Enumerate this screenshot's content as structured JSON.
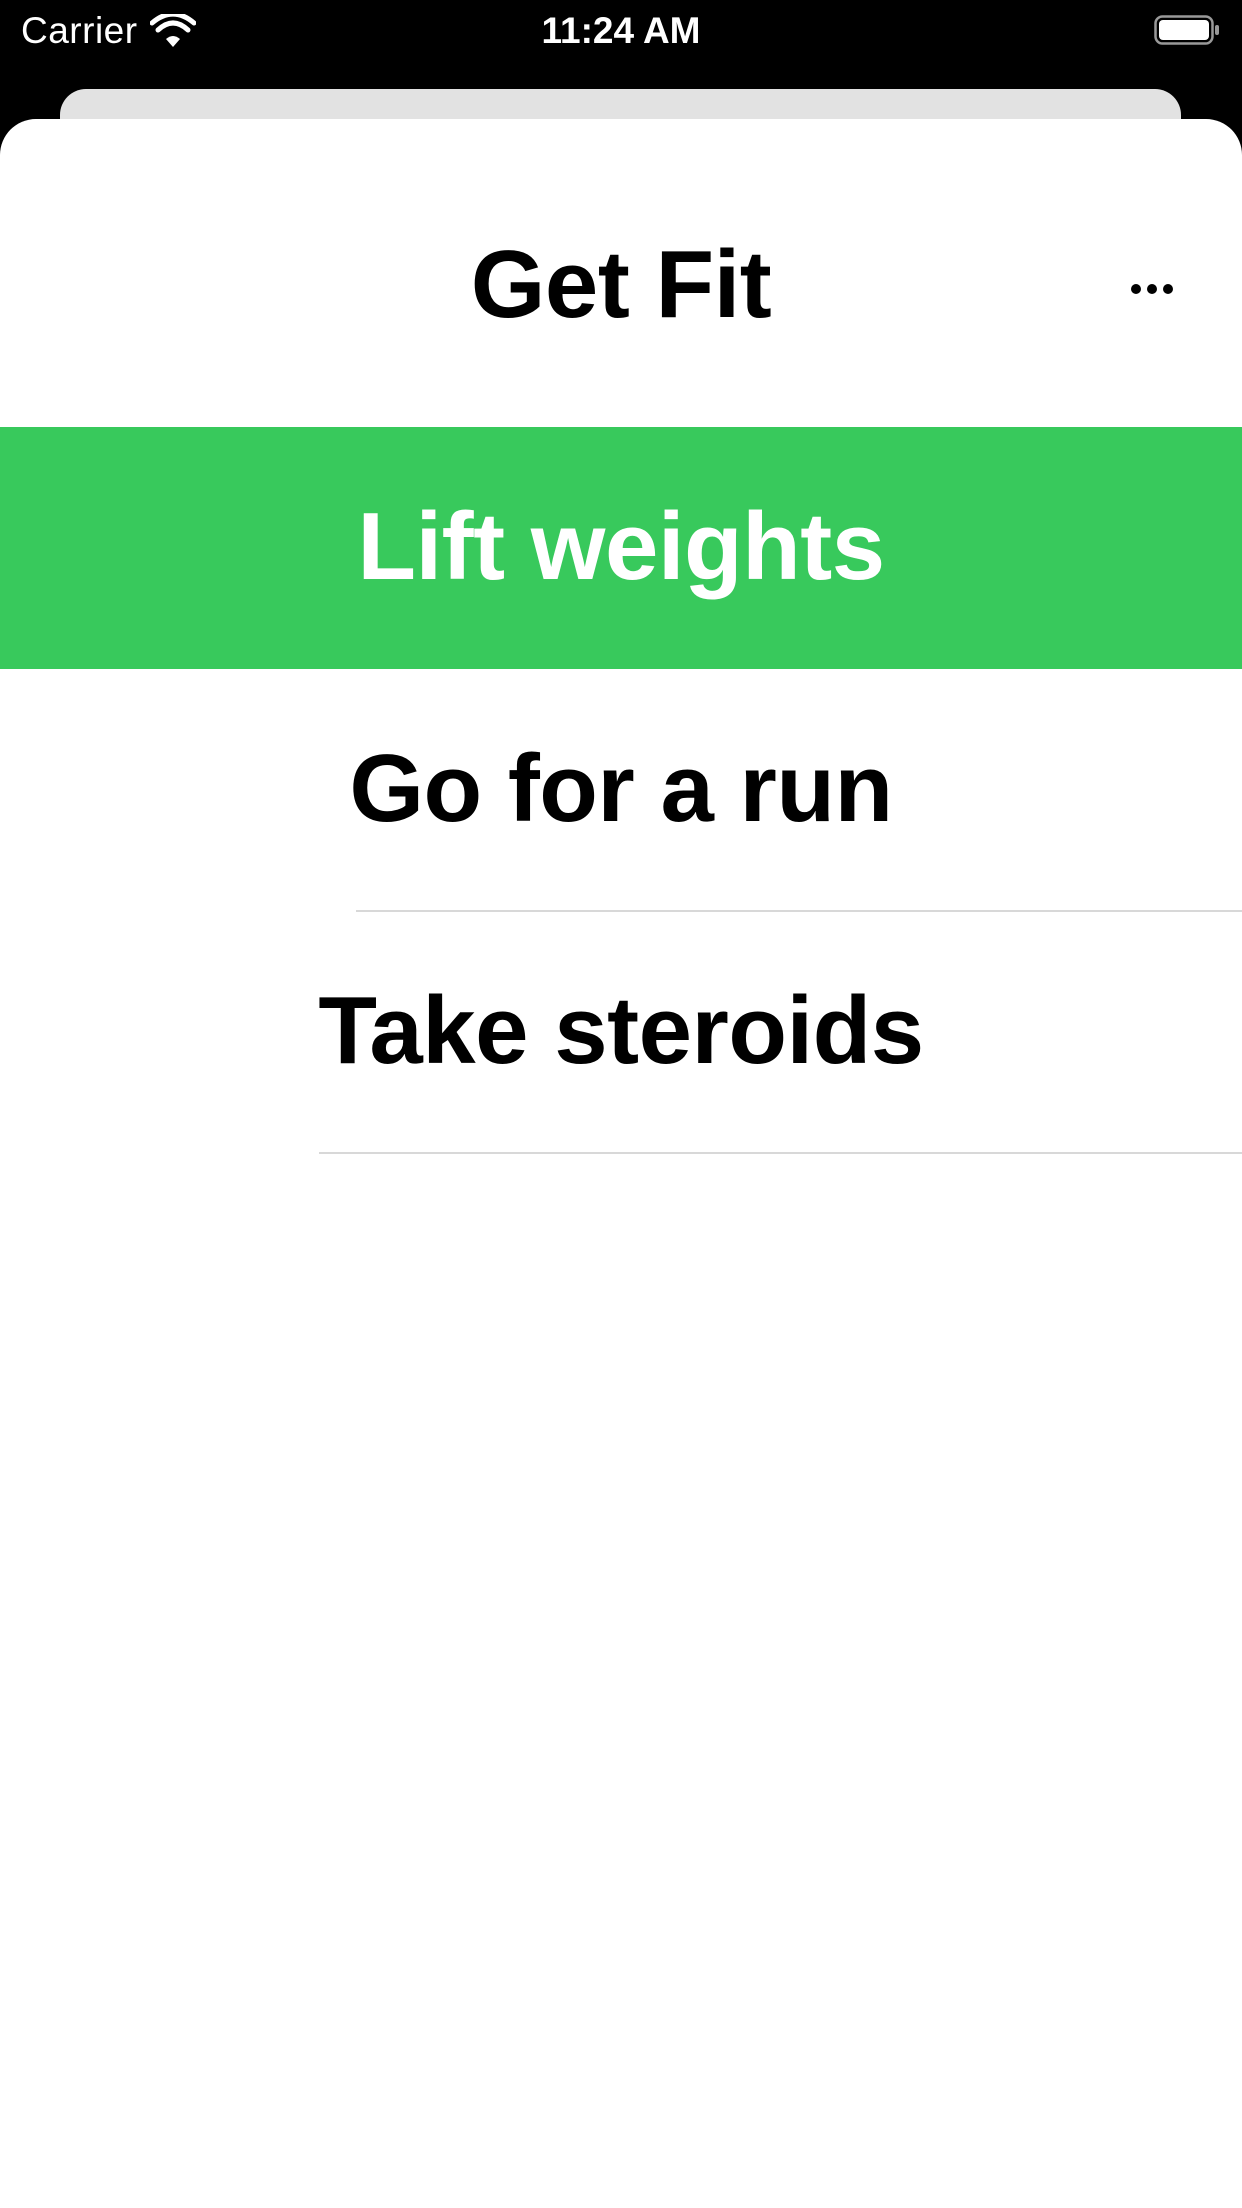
{
  "status_bar": {
    "carrier": "Carrier",
    "time": "11:24 AM",
    "wifi_icon": "wifi-icon",
    "battery_icon": "battery-full-icon"
  },
  "header": {
    "title": "Get Fit",
    "more_icon": "ellipsis-icon"
  },
  "list": {
    "items": [
      {
        "label": "Lift weights",
        "selected": true
      },
      {
        "label": "Go for a run",
        "selected": false
      },
      {
        "label": "Take steroids",
        "selected": false
      }
    ]
  },
  "colors": {
    "accent_green": "#38c95c",
    "sheet_background": "#ffffff",
    "status_bar_background": "#000000",
    "separator": "#d8d8d8"
  }
}
